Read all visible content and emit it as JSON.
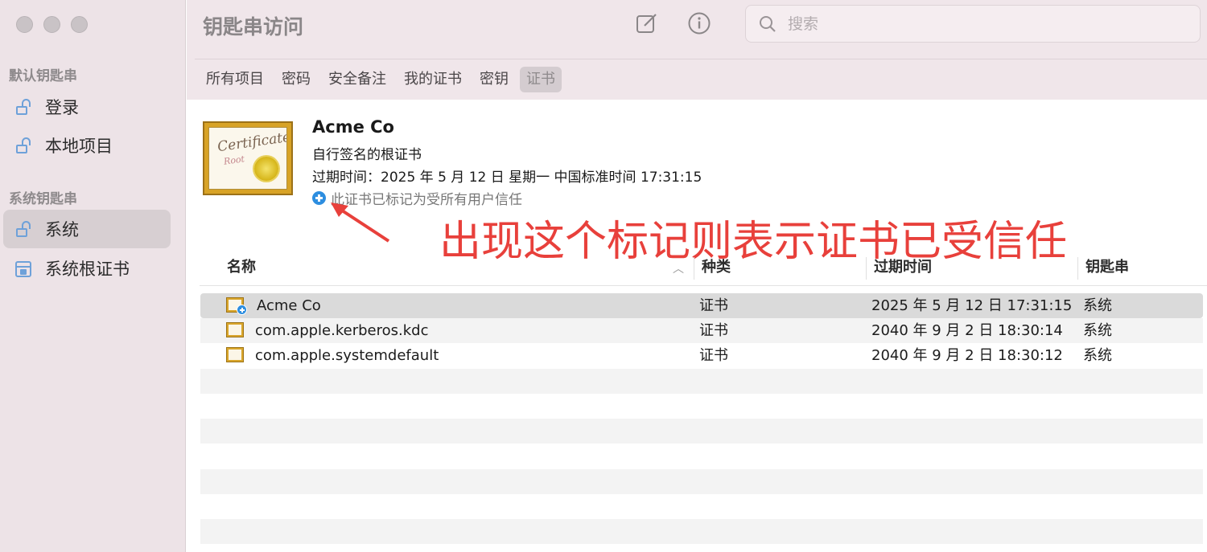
{
  "window": {
    "title": "钥匙串访问"
  },
  "toolbar": {
    "compose_icon": "compose-icon",
    "info_icon": "info-icon"
  },
  "search": {
    "placeholder": "搜索",
    "value": ""
  },
  "sidebar": {
    "section_default": "默认钥匙串",
    "section_system": "系统钥匙串",
    "items": [
      {
        "label": "登录",
        "icon": "lock-icon"
      },
      {
        "label": "本地项目",
        "icon": "lock-icon"
      },
      {
        "label": "系统",
        "icon": "lock-icon",
        "selected": true
      },
      {
        "label": "系统根证书",
        "icon": "cabinet-icon"
      }
    ]
  },
  "tabs": [
    {
      "label": "所有项目"
    },
    {
      "label": "密码"
    },
    {
      "label": "安全备注"
    },
    {
      "label": "我的证书"
    },
    {
      "label": "密钥"
    },
    {
      "label": "证书",
      "active": true
    }
  ],
  "detail": {
    "cert_word": "Certificate",
    "cert_root": "Root",
    "name": "Acme Co",
    "kind": "自行签名的根证书",
    "expires": "过期时间：2025 年 5 月 12 日 星期一 中国标准时间 17:31:15",
    "trust": "此证书已标记为受所有用户信任"
  },
  "annotation": {
    "text": "出现这个标记则表示证书已受信任",
    "color": "#e8403b"
  },
  "table": {
    "headers": {
      "name": "名称",
      "kind": "种类",
      "expires": "过期时间",
      "keychain": "钥匙串"
    },
    "rows": [
      {
        "name": "Acme Co",
        "kind": "证书",
        "expires": "2025 年 5 月 12 日 17:31:15",
        "keychain": "系统"
      },
      {
        "name": "com.apple.kerberos.kdc",
        "kind": "证书",
        "expires": "2040 年 9 月 2 日 18:30:14",
        "keychain": "系统"
      },
      {
        "name": "com.apple.systemdefault",
        "kind": "证书",
        "expires": "2040 年 9 月 2 日 18:30:12",
        "keychain": "系统"
      }
    ]
  }
}
